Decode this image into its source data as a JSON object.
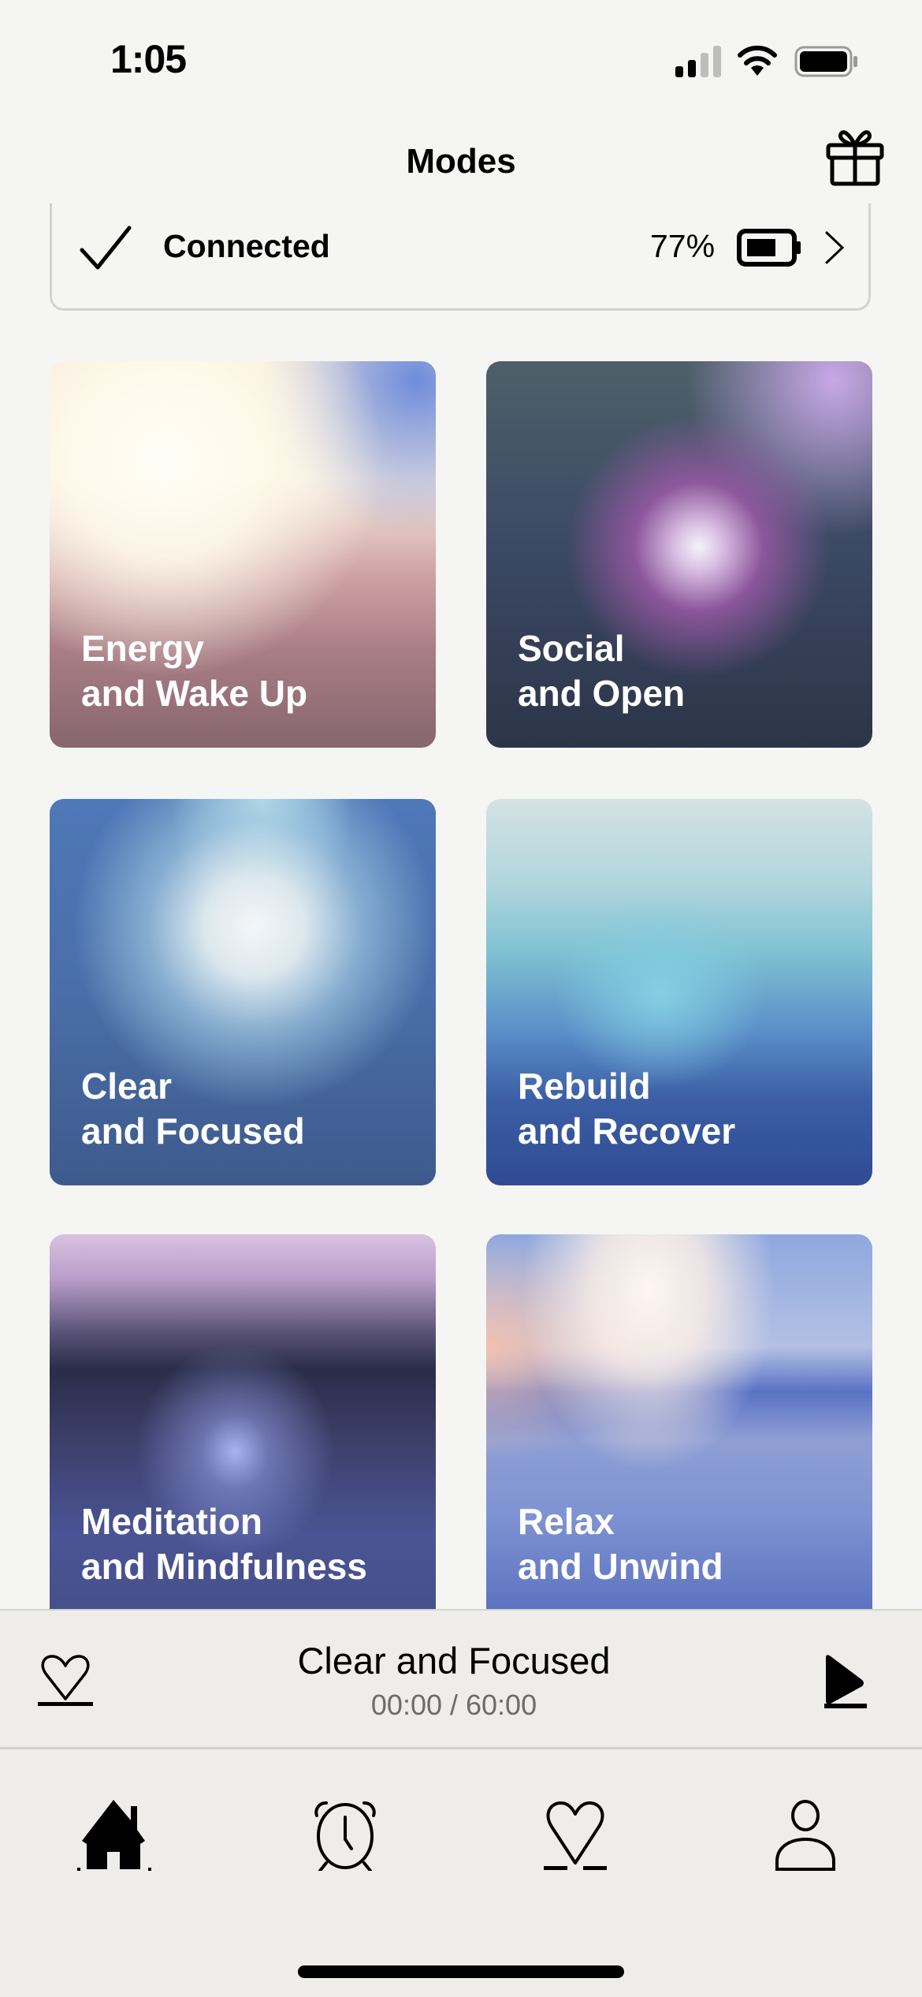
{
  "status_bar": {
    "time": "1:05",
    "signal_icon": "cellular-signal-icon",
    "wifi_icon": "wifi-icon",
    "battery_icon": "battery-icon"
  },
  "header": {
    "title": "Modes",
    "gift_icon": "gift-icon"
  },
  "device": {
    "status": "Connected",
    "battery_percent": "77%",
    "battery_level": 0.77
  },
  "modes": [
    {
      "line1": "Energy",
      "line2": "and Wake Up",
      "label": "Energy\nand Wake Up"
    },
    {
      "line1": "Social",
      "line2": "and Open",
      "label": "Social\nand Open"
    },
    {
      "line1": "Clear",
      "line2": "and Focused",
      "label": "Clear\nand Focused"
    },
    {
      "line1": "Rebuild",
      "line2": "and Recover",
      "label": "Rebuild\nand Recover"
    },
    {
      "line1": "Meditation",
      "line2": "and Mindfulness",
      "label": "Meditation\nand Mindfulness"
    },
    {
      "line1": "Relax",
      "line2": "and Unwind",
      "label": "Relax\nand Unwind"
    }
  ],
  "player": {
    "title": "Clear and Focused",
    "time": "00:00 / 60:00",
    "elapsed": "00:00",
    "duration": "60:00"
  },
  "tabs": [
    {
      "name": "home",
      "icon": "home-icon",
      "active": true
    },
    {
      "name": "alarm",
      "icon": "alarm-clock-icon",
      "active": false
    },
    {
      "name": "favorites",
      "icon": "heart-icon",
      "active": false
    },
    {
      "name": "profile",
      "icon": "person-icon",
      "active": false
    }
  ]
}
